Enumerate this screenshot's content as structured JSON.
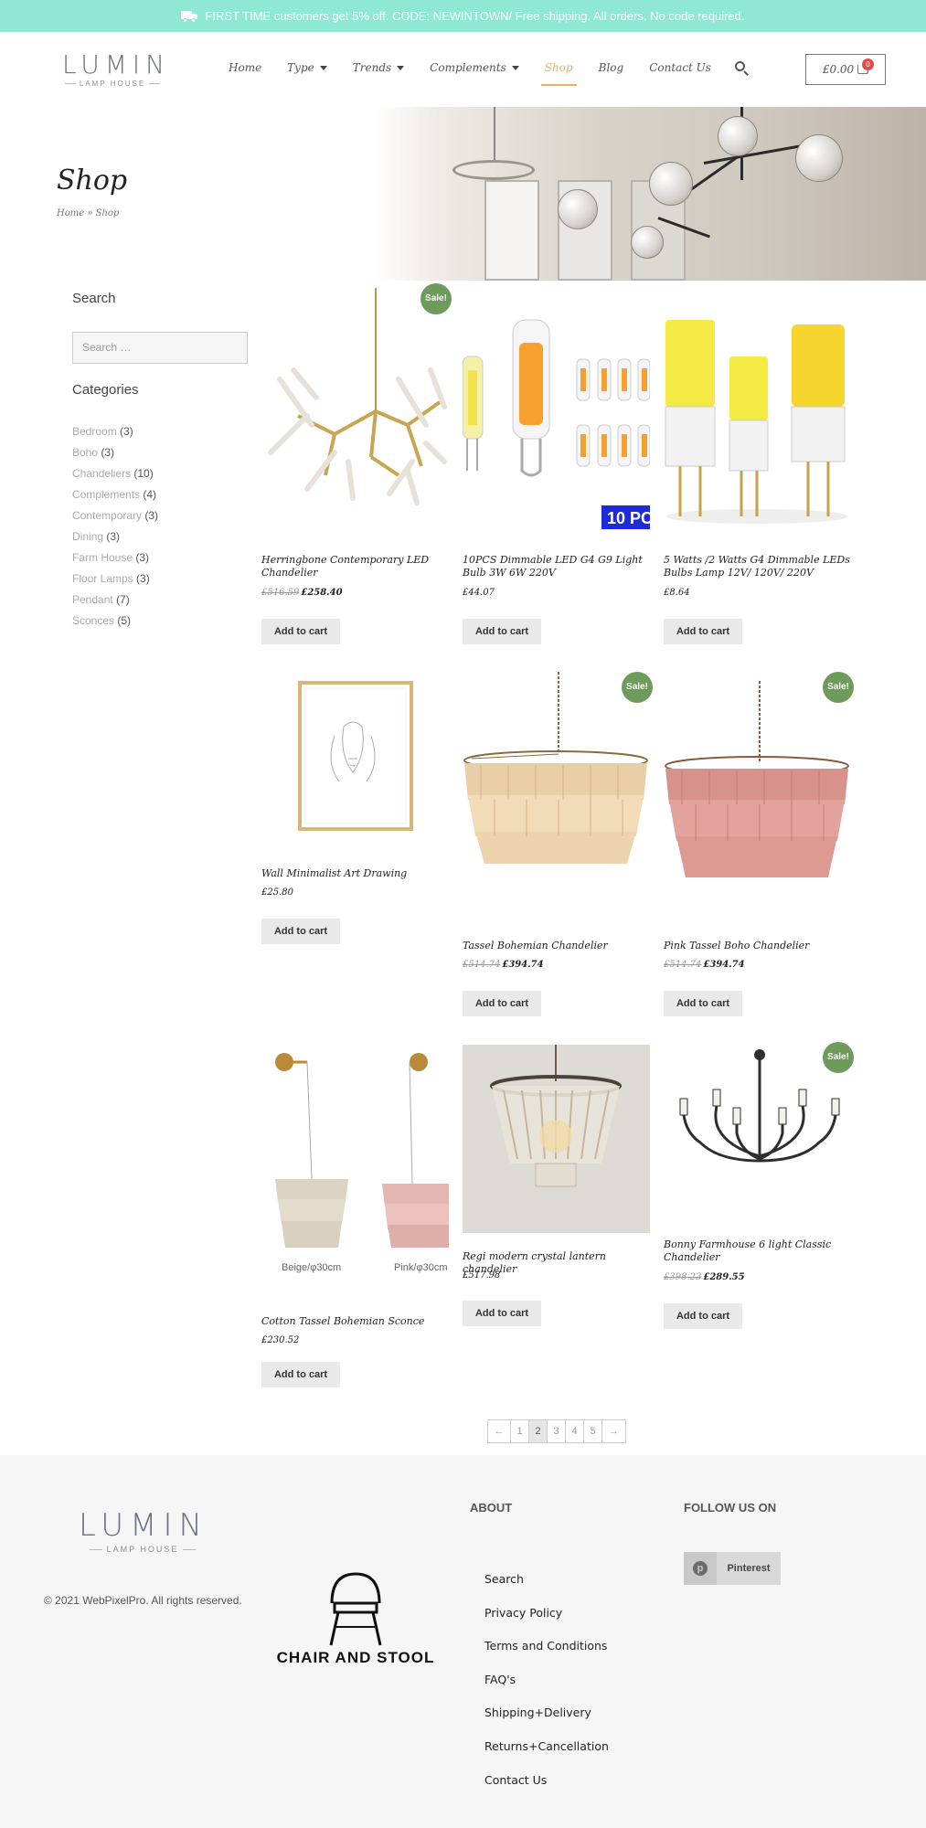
{
  "topbar": {
    "text": "FIRST TIME customers get 5% off. CODE: NEWINTOWN/ Free shipping. All orders. No code required."
  },
  "header": {
    "logo_word": "LUMIN",
    "logo_sub": "LAMP HOUSE",
    "nav": [
      {
        "label": "Home",
        "dropdown": false
      },
      {
        "label": "Type",
        "dropdown": true
      },
      {
        "label": "Trends",
        "dropdown": true
      },
      {
        "label": "Complements",
        "dropdown": true
      },
      {
        "label": "Shop",
        "dropdown": false,
        "active": true
      },
      {
        "label": "Blog",
        "dropdown": false
      },
      {
        "label": "Contact Us",
        "dropdown": false
      }
    ],
    "cart_total": "£0.00",
    "cart_count": "0"
  },
  "hero": {
    "title": "Shop",
    "breadcrumb": "Home » Shop"
  },
  "sidebar": {
    "search_title": "Search",
    "search_placeholder": "Search …",
    "categories_title": "Categories",
    "categories": [
      {
        "name": "Bedroom",
        "count": "(3)"
      },
      {
        "name": "Boho",
        "count": "(3)"
      },
      {
        "name": "Chandeliers",
        "count": "(10)"
      },
      {
        "name": "Complements",
        "count": "(4)"
      },
      {
        "name": "Contemporary",
        "count": "(3)"
      },
      {
        "name": "Dining",
        "count": "(3)"
      },
      {
        "name": "Farm House",
        "count": "(3)"
      },
      {
        "name": "Floor Lamps",
        "count": "(3)"
      },
      {
        "name": "Pendant",
        "count": "(7)"
      },
      {
        "name": "Sconces",
        "count": "(5)"
      }
    ]
  },
  "products": [
    {
      "name": "Herringbone Contemporary LED Chandelier",
      "old_price": "£516.59",
      "price": "£258.40",
      "sale": true,
      "button": "Add to cart"
    },
    {
      "name": "10PCS Dimmable LED G4 G9 Light Bulb 3W 6W 220V",
      "old_price": "",
      "price": "£44.07",
      "sale": false,
      "button": "Add to cart",
      "image_text": "10 PC"
    },
    {
      "name": "5 Watts /2 Watts G4 Dimmable LEDs Bulbs Lamp 12V/ 120V/ 220V",
      "old_price": "",
      "price": "£8.64",
      "sale": false,
      "button": "Add to cart"
    },
    {
      "name": "Wall Minimalist Art Drawing",
      "old_price": "",
      "price": "£25.80",
      "sale": false,
      "button": "Add to cart"
    },
    {
      "name": "Tassel Bohemian Chandelier",
      "old_price": "£514.74",
      "price": "£394.74",
      "sale": true,
      "button": "Add to cart"
    },
    {
      "name": "Pink Tassel Boho Chandelier",
      "old_price": "£514.74",
      "price": "£394.74",
      "sale": true,
      "button": "Add to cart"
    },
    {
      "name": "Cotton Tassel Bohemian Sconce",
      "old_price": "",
      "price": "£230.52",
      "sale": false,
      "button": "Add to cart",
      "image_captions": [
        "Beige/φ30cm",
        "Pink/φ30cm"
      ]
    },
    {
      "name": "Regi modern crystal lantern chandelier",
      "old_price": "",
      "price": "£517.98",
      "sale": false,
      "button": "Add to cart"
    },
    {
      "name": "Bonny Farmhouse 6 light Classic Chandelier",
      "old_price": "£398.23",
      "price": "£289.55",
      "sale": true,
      "button": "Add to cart"
    }
  ],
  "sale_label": "Sale!",
  "pagination": {
    "prev": "←",
    "pages": [
      "1",
      "2",
      "3",
      "4",
      "5"
    ],
    "current": "2",
    "next": "→"
  },
  "footer": {
    "logo_word": "LUMIN",
    "logo_sub": "LAMP HOUSE",
    "copyright": "© 2021 WebPixelPro. All rights reserved.",
    "brand_text": "CHAIR AND STOOL",
    "about_title": "ABOUT",
    "about_links": [
      "Search",
      "Privacy Policy",
      "Terms and Conditions",
      "FAQ's",
      "Shipping+Delivery",
      "Returns+Cancellation",
      "Contact Us"
    ],
    "follow_title": "FOLLOW US ON",
    "social_label": "Pinterest"
  },
  "colors": {
    "topbar": "#8ee8d3",
    "accent": "#e7b264",
    "sale": "#6e9a5b",
    "badge": "#e24b4b"
  }
}
